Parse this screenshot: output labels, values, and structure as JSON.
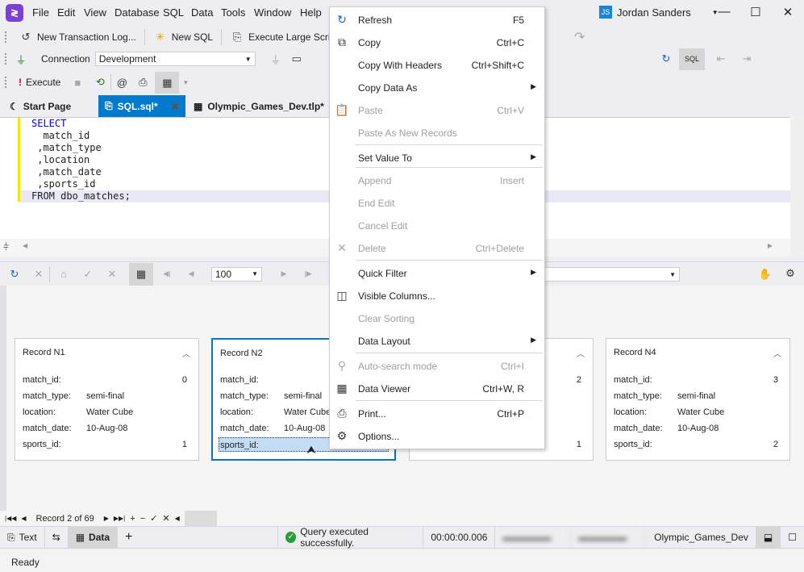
{
  "menubar": {
    "items": [
      "File",
      "Edit",
      "View",
      "Database",
      "SQL",
      "Data",
      "Tools",
      "Window",
      "Help"
    ],
    "user_initials": "JS",
    "user_name": "Jordan Sanders"
  },
  "toolbar1": {
    "new_transaction_log": "New Transaction Log...",
    "new_sql": "New SQL",
    "execute_large_script": "Execute Large Script..."
  },
  "toolbar2": {
    "connection_label": "Connection",
    "connection_value": "Development"
  },
  "toolbar3": {
    "execute": "Execute"
  },
  "tabs": [
    {
      "label": "Start Page"
    },
    {
      "label": "SQL.sql*"
    },
    {
      "label": "Olympic_Games_Dev.tlp*"
    }
  ],
  "editor": {
    "lines": [
      "SELECT",
      "  match_id",
      " ,match_type",
      " ,location",
      " ,match_date",
      " ,sports_id",
      "FROM dbo_matches;"
    ]
  },
  "grid_toolbar": {
    "page_size": "100"
  },
  "cards": [
    {
      "title": "Record N1",
      "fields": [
        {
          "name": "match_id:",
          "value": "0"
        },
        {
          "name": "match_type:",
          "value": "semi-final"
        },
        {
          "name": "location:",
          "value": "Water Cube"
        },
        {
          "name": "match_date:",
          "value": "10-Aug-08"
        },
        {
          "name": "sports_id:",
          "value": "1"
        }
      ]
    },
    {
      "title": "Record N2",
      "fields": [
        {
          "name": "match_id:",
          "value": ""
        },
        {
          "name": "match_type:",
          "value": "semi-final"
        },
        {
          "name": "location:",
          "value": "Water Cube"
        },
        {
          "name": "match_date:",
          "value": "10-Aug-08"
        },
        {
          "name": "sports_id:",
          "value": ""
        }
      ]
    },
    {
      "title": "",
      "fields": [
        {
          "name": "",
          "value": "2"
        },
        {
          "name": "",
          "value": ""
        },
        {
          "name": "",
          "value": ""
        },
        {
          "name": "",
          "value": ""
        },
        {
          "name": "",
          "value": "1"
        }
      ]
    },
    {
      "title": "Record N4",
      "fields": [
        {
          "name": "match_id:",
          "value": "3"
        },
        {
          "name": "match_type:",
          "value": "semi-final"
        },
        {
          "name": "location:",
          "value": "Water Cube"
        },
        {
          "name": "match_date:",
          "value": "10-Aug-08"
        },
        {
          "name": "sports_id:",
          "value": "2"
        }
      ]
    }
  ],
  "navigator": {
    "record_text": "Record 2 of 69"
  },
  "bottom_tabs": {
    "text": "Text",
    "data": "Data",
    "query_status": "Query executed successfully.",
    "elapsed": "00:00:00.006",
    "database": "Olympic_Games_Dev"
  },
  "status": {
    "text": "Ready"
  },
  "context_menu": {
    "items": [
      {
        "label": "Refresh",
        "shortcut": "F5",
        "icon": "refresh-icon"
      },
      {
        "label": "Copy",
        "shortcut": "Ctrl+C",
        "icon": "copy-icon"
      },
      {
        "label": "Copy With Headers",
        "shortcut": "Ctrl+Shift+C"
      },
      {
        "label": "Copy Data As",
        "submenu": true
      },
      {
        "label": "Paste",
        "shortcut": "Ctrl+V",
        "disabled": true,
        "icon": "paste-icon"
      },
      {
        "label": "Paste As New Records",
        "disabled": true
      },
      {
        "label": "Set Value To",
        "submenu": true
      },
      {
        "label": "Append",
        "shortcut": "Insert",
        "disabled": true
      },
      {
        "label": "End Edit",
        "disabled": true
      },
      {
        "label": "Cancel Edit",
        "disabled": true
      },
      {
        "label": "Delete",
        "shortcut": "Ctrl+Delete",
        "disabled": true,
        "icon": "delete-icon"
      },
      {
        "label": "Quick Filter",
        "submenu": true
      },
      {
        "label": "Visible Columns...",
        "icon": "columns-icon"
      },
      {
        "label": "Clear Sorting",
        "disabled": true
      },
      {
        "label": "Data Layout",
        "submenu": true
      },
      {
        "label": "Auto-search mode",
        "shortcut": "Ctrl+I",
        "disabled": true,
        "icon": "auto-search-icon"
      },
      {
        "label": "Data Viewer",
        "shortcut": "Ctrl+W, R",
        "icon": "data-viewer-icon"
      },
      {
        "label": "Print...",
        "shortcut": "Ctrl+P",
        "icon": "print-icon"
      },
      {
        "label": "Options...",
        "icon": "gear-icon"
      }
    ]
  },
  "colors": {
    "accent": "#007acc",
    "logo": "#7b3fd6",
    "success": "#2a9d3a"
  }
}
